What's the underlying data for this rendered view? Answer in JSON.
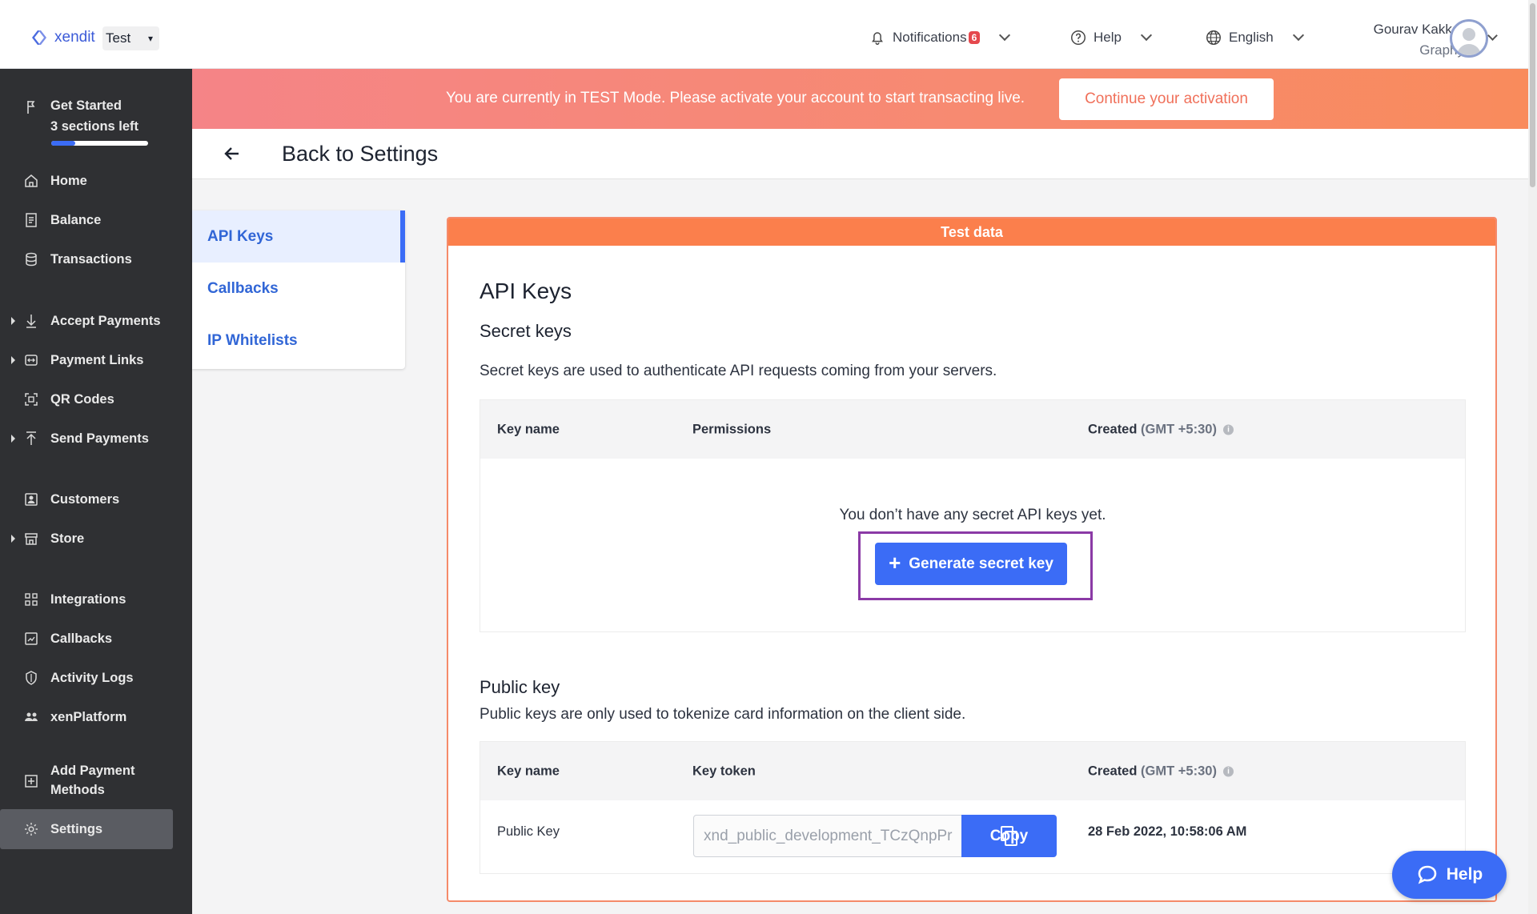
{
  "brand": {
    "name": "xendit",
    "env_value": "Test"
  },
  "topbar": {
    "notifications_label": "Notifications",
    "notifications_count": "6",
    "help_label": "Help",
    "language_label": "English",
    "user_name": "Gourav Kakkar",
    "user_org": "Graphy"
  },
  "banner": {
    "message": "You are currently in TEST Mode. Please activate your account to start transacting live.",
    "cta": "Continue your activation"
  },
  "sidebar": {
    "get_started": {
      "title": "Get Started",
      "subtitle": "3 sections left",
      "progress": 0.25
    },
    "items": [
      {
        "label": "Home",
        "icon": "home-icon"
      },
      {
        "label": "Balance",
        "icon": "balance-icon"
      },
      {
        "label": "Transactions",
        "icon": "transactions-icon"
      },
      {
        "label": "Accept Payments",
        "icon": "accept-payments-icon",
        "expandable": true
      },
      {
        "label": "Payment Links",
        "icon": "payment-links-icon",
        "expandable": true
      },
      {
        "label": "QR Codes",
        "icon": "qr-code-icon"
      },
      {
        "label": "Send Payments",
        "icon": "send-payments-icon",
        "expandable": true
      },
      {
        "label": "Customers",
        "icon": "customers-icon"
      },
      {
        "label": "Store",
        "icon": "store-icon",
        "expandable": true
      },
      {
        "label": "Integrations",
        "icon": "integrations-icon"
      },
      {
        "label": "Callbacks",
        "icon": "callbacks-icon"
      },
      {
        "label": "Activity Logs",
        "icon": "shield-icon"
      },
      {
        "label": "xenPlatform",
        "icon": "people-icon"
      },
      {
        "label": "Add Payment Methods",
        "icon": "add-box-icon"
      },
      {
        "label": "Settings",
        "icon": "gear-icon",
        "active": true
      }
    ]
  },
  "header": {
    "back_label": "Back to Settings"
  },
  "submenu": {
    "items": [
      {
        "label": "API Keys",
        "active": true
      },
      {
        "label": "Callbacks"
      },
      {
        "label": "IP Whitelists"
      }
    ]
  },
  "card": {
    "badge": "Test data",
    "title": "API Keys",
    "secret": {
      "heading": "Secret keys",
      "description": "Secret keys are used to authenticate API requests coming from your servers.",
      "columns": {
        "key_name": "Key name",
        "permissions": "Permissions",
        "created": "Created",
        "created_tz": "(GMT +5:30)"
      },
      "empty_message": "You don’t have any secret API keys yet.",
      "generate_label": "Generate secret key"
    },
    "public": {
      "heading": "Public key",
      "description": "Public keys are only used to tokenize card information on the client side.",
      "columns": {
        "key_name": "Key name",
        "key_token": "Key token",
        "created": "Created",
        "created_tz": "(GMT +5:30)"
      },
      "row": {
        "name": "Public Key",
        "token": "xnd_public_development_TCzQnpPr",
        "copy_label": "Copy",
        "created": "28 Feb 2022, 10:58:06 AM"
      }
    }
  },
  "help_fab": {
    "label": "Help"
  },
  "colors": {
    "accent": "#3b6cf6",
    "banner_start": "#f58487",
    "banner_end": "#f98b5c",
    "test_header": "#fb7f4c",
    "sidebar_bg": "#2f3033"
  }
}
